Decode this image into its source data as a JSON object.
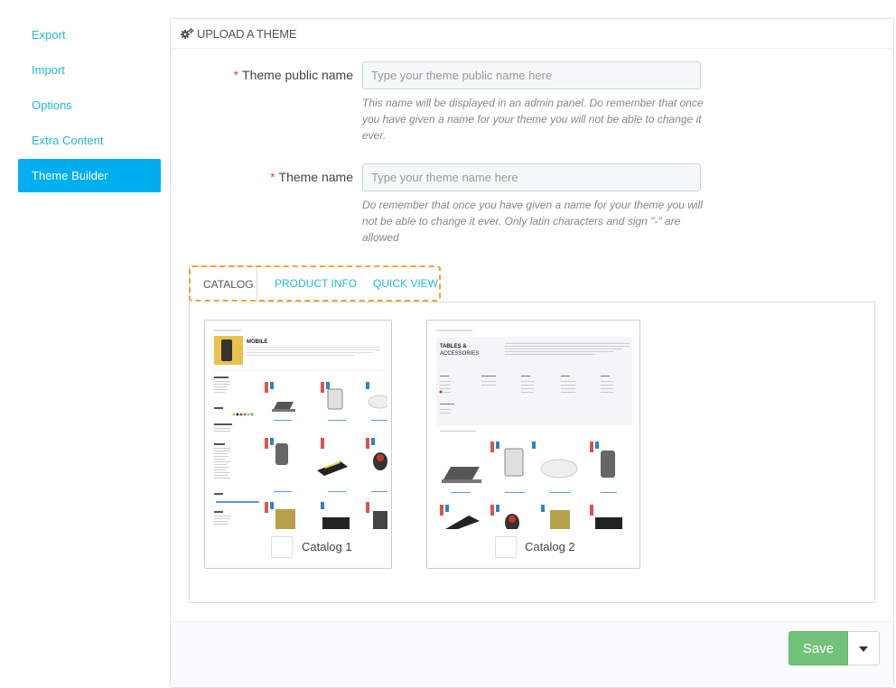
{
  "sidebar": {
    "items": [
      {
        "label": "Export"
      },
      {
        "label": "Import"
      },
      {
        "label": "Options"
      },
      {
        "label": "Extra Content"
      },
      {
        "label": "Theme Builder"
      }
    ]
  },
  "panel": {
    "heading_icon": "cogs-icon",
    "heading": "UPLOAD A THEME"
  },
  "form": {
    "public_name": {
      "required_mark": "*",
      "label": "Theme public name",
      "placeholder": "Type your theme public name here",
      "value": "",
      "help": "This name will be displayed in an admin panel. Do remember that once you have given a name for your theme you will not be able to change it ever."
    },
    "theme_name": {
      "required_mark": "*",
      "label": "Theme name",
      "placeholder": "Type your theme name here",
      "value": "",
      "help": "Do remember that once you have given a name for your theme you will not be able to change it ever. Only latin characters and sign \"-\" are allowed"
    }
  },
  "tabs": [
    {
      "label": "CATALOG",
      "active": true
    },
    {
      "label": "PRODUCT INFO",
      "active": false
    },
    {
      "label": "QUICK VIEW",
      "active": false
    }
  ],
  "highlight_color": "#f4a22e",
  "catalogs": [
    {
      "label": "Catalog 1",
      "thumb_title": "MOBILE"
    },
    {
      "label": "Catalog 2",
      "thumb_title": "TABLES &",
      "thumb_title_2": "ACCESSORIES"
    }
  ],
  "footer": {
    "save_label": "Save",
    "save_color": "#72c279",
    "dropdown_icon": "caret-down-icon"
  },
  "colors": {
    "accent": "#25b9d7",
    "active_sidebar": "#00aff0",
    "required": "#e74c3c"
  }
}
